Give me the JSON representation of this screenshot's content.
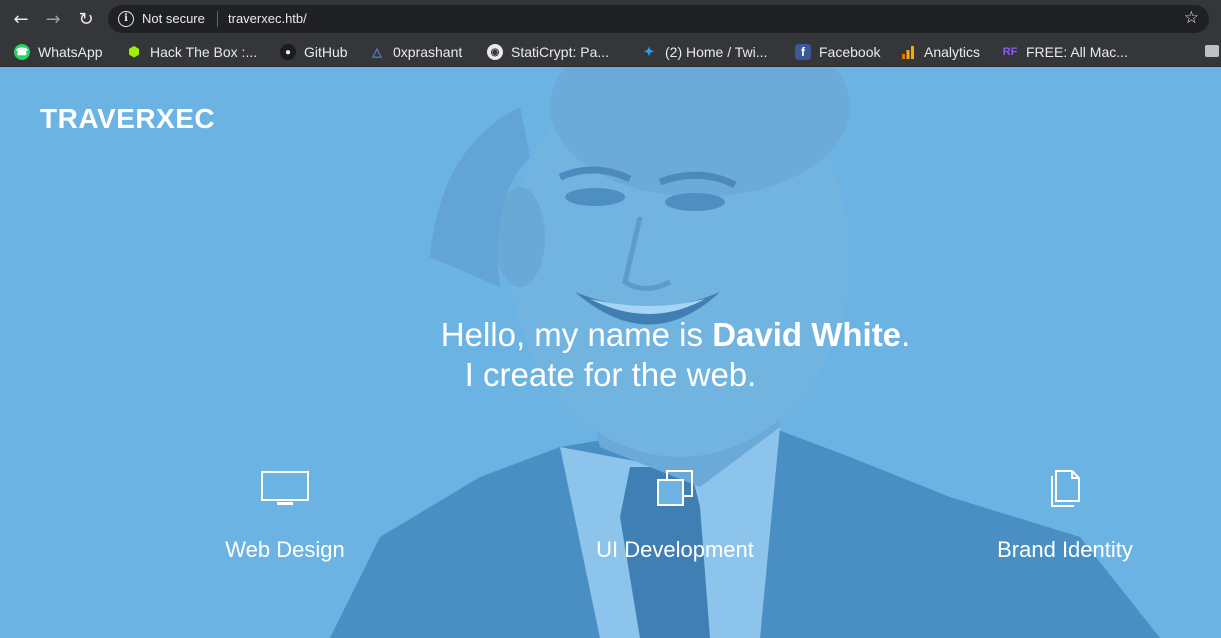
{
  "browser": {
    "security_label": "Not secure",
    "url": "traverxec.htb/",
    "bookmarks": [
      {
        "label": "WhatsApp",
        "icon": "whatsapp-icon",
        "color": "#25d366"
      },
      {
        "label": "Hack The Box :...",
        "icon": "hackthebox-icon",
        "color": "#9fef00"
      },
      {
        "label": "GitHub",
        "icon": "github-icon",
        "color": "#e8eaed"
      },
      {
        "label": "0xprashant",
        "icon": "triangle-logo-icon",
        "color": "#5a7fd6"
      },
      {
        "label": "StatiCrypt: Pa...",
        "icon": "globe-icon",
        "color": "#e8eaed"
      },
      {
        "label": "(2) Home / Twi...",
        "icon": "twitter-icon",
        "color": "#1da1f2"
      },
      {
        "label": "Facebook",
        "icon": "facebook-icon",
        "color": "#3b5998"
      },
      {
        "label": "Analytics",
        "icon": "analytics-icon",
        "color": "#f9ab00"
      },
      {
        "label": "FREE: All Mac...",
        "icon": "rf-logo-icon",
        "color": "#8a5cf6"
      }
    ]
  },
  "site": {
    "brand": "TRAVERXEC",
    "hero": {
      "line1_prefix": "Hello, my name is ",
      "line1_name": "David White",
      "line1_suffix": ".",
      "line2": "I create for the web."
    },
    "services": [
      {
        "label": "Web Design",
        "icon": "monitor-icon"
      },
      {
        "label": "UI Development",
        "icon": "stacked-windows-icon"
      },
      {
        "label": "Brand Identity",
        "icon": "documents-icon"
      }
    ],
    "accent_color": "#6bb3e3"
  }
}
